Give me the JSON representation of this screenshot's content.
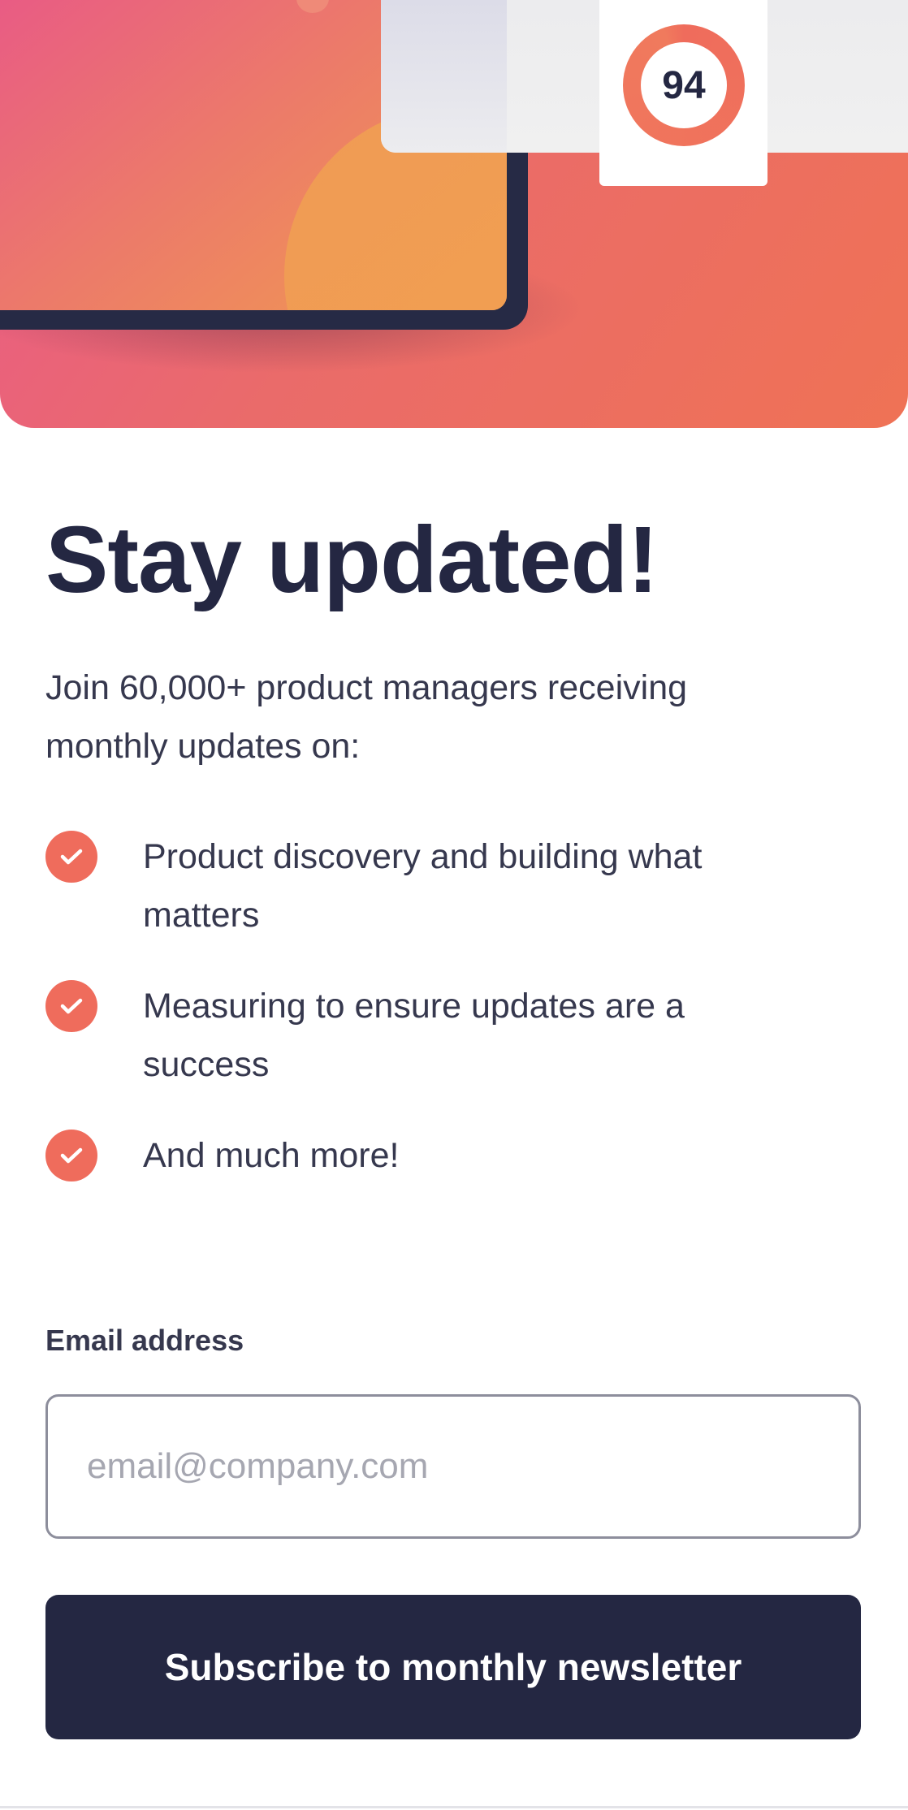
{
  "hero": {
    "score": "94",
    "accent": "#ef6c5c",
    "gradient_start": "#e95a8a",
    "gradient_end": "#ef7255"
  },
  "main": {
    "title": "Stay updated!",
    "intro": "Join 60,000+ product managers receiving monthly updates on:",
    "features": [
      {
        "icon": "check-icon",
        "text": "Product discovery and building what matters"
      },
      {
        "icon": "check-icon",
        "text": "Measuring to ensure updates are a success"
      },
      {
        "icon": "check-icon",
        "text": "And much more!"
      }
    ]
  },
  "form": {
    "email_label": "Email address",
    "email_placeholder": "email@company.com",
    "email_value": "",
    "submit_label": "Subscribe to monthly newsletter",
    "button_color": "#242742"
  }
}
